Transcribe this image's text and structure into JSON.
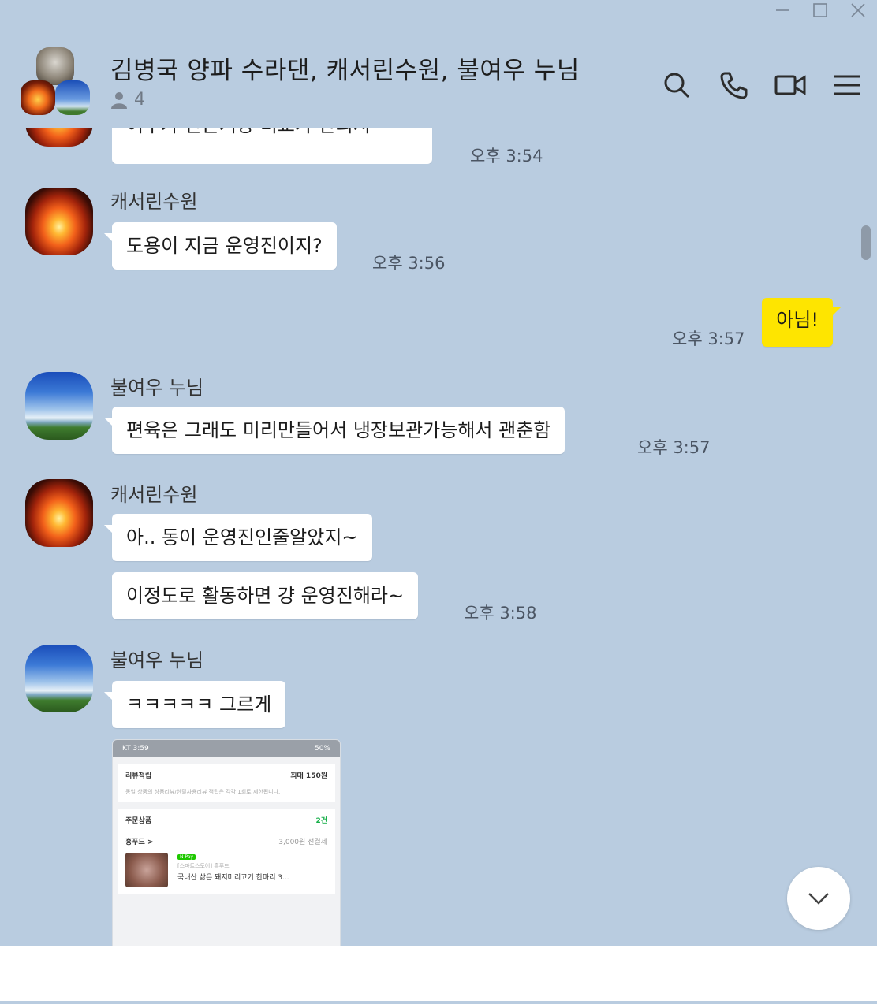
{
  "window": {
    "controls": [
      "minimize",
      "maximize",
      "close"
    ]
  },
  "header": {
    "title": "김병국 양파 수라댄, 캐서린수원, 불여우 누님",
    "member_count": "4",
    "icons": [
      "search-icon",
      "call-icon",
      "video-call-icon",
      "menu-icon"
    ]
  },
  "messages": [
    {
      "sender": "",
      "text": "여우가 만든거랑 비교가 안되지~~~",
      "time": "오후 3:54"
    },
    {
      "sender": "캐서린수원",
      "text": "도용이 지금 운영진이지?",
      "time": "오후 3:56"
    },
    {
      "sender": "me",
      "text": "아님!",
      "time": "오후 3:57"
    },
    {
      "sender": "불여우 누님",
      "text": "편육은 그래도 미리만들어서 냉장보관가능해서 괜춘함",
      "time": "오후 3:57"
    },
    {
      "sender": "캐서린수원",
      "text": "아.. 동이 운영진인줄알았지~",
      "time": ""
    },
    {
      "sender": "",
      "text": "이정도로 활동하면 걍 운영진해라~",
      "time": "오후 3:58"
    },
    {
      "sender": "불여우 누님",
      "text": "ㅋㅋㅋㅋㅋ 그르게",
      "time": ""
    }
  ],
  "image_message": {
    "status_left": "KT 3:59",
    "status_right": "50%",
    "review_label": "리뷰적립",
    "review_max": "최대 150원",
    "review_note": "동일 상품의 상품리뷰/한달사용리뷰 적립은 각각 1회로 제한됩니다.",
    "order_label": "주문상품",
    "order_count": "2건",
    "store": "흥푸드 >",
    "shipping": "3,000원 선결제",
    "npay": "N Pay",
    "product_store": "[스마트스토어] 흥푸드",
    "product_name": "국내산 삶은 돼지머리고기 한마리 3..."
  },
  "input": {
    "placeholder": ""
  },
  "colors": {
    "background": "#b9cce0",
    "my_bubble": "#fee500",
    "bubble": "#ffffff"
  }
}
